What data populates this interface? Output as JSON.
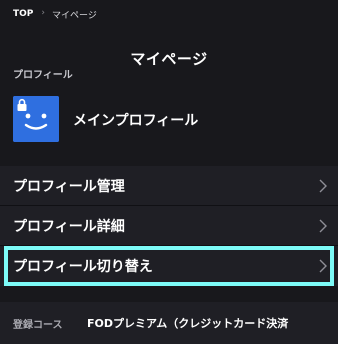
{
  "breadcrumb": {
    "home": "TOP",
    "separator": "›",
    "current": "マイページ"
  },
  "page": {
    "title": "マイページ"
  },
  "profile_section": {
    "label": "プロフィール",
    "profile_name": "メインプロフィール",
    "avatar_icon": "smiley-face-icon",
    "lock_icon": "lock-icon",
    "avatar_color": "#2f6fe0"
  },
  "menu": {
    "items": [
      {
        "label": "プロフィール管理",
        "icon": "chevron-right-icon"
      },
      {
        "label": "プロフィール詳細",
        "icon": "chevron-right-icon"
      },
      {
        "label": "プロフィール切り替え",
        "icon": "chevron-right-icon"
      }
    ],
    "highlight_color": "#7dfbf8"
  },
  "course": {
    "label": "登録コース",
    "value": "FODプレミアム（クレジットカード決済"
  },
  "colors": {
    "background": "#18181c",
    "panel": "#1f1f25"
  }
}
